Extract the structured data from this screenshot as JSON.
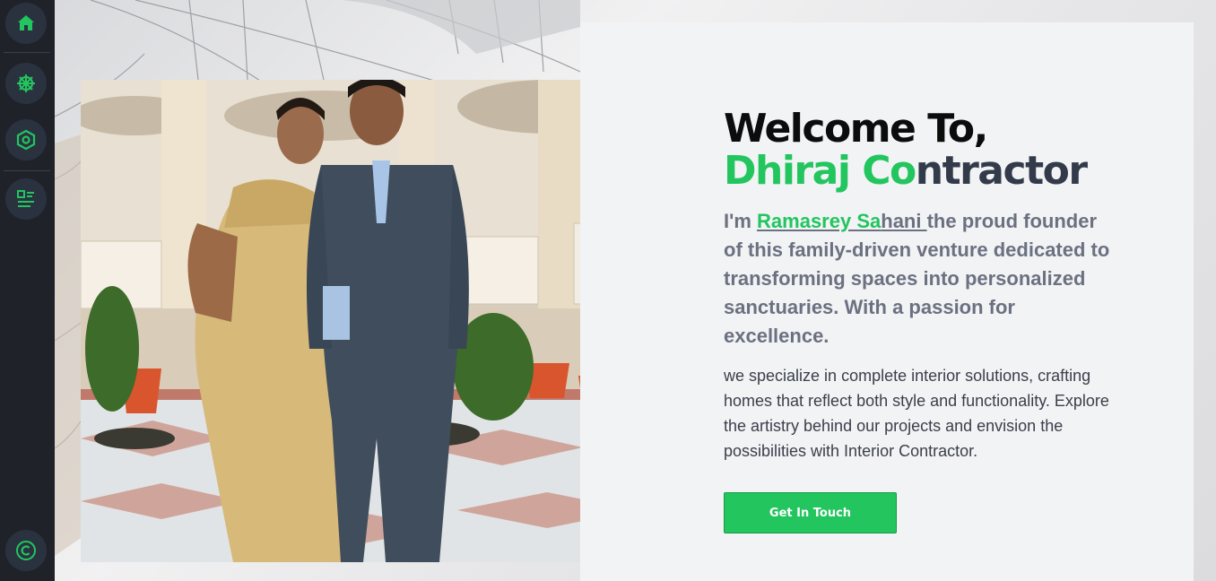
{
  "sidebar": {
    "items": [
      {
        "icon": "home-icon",
        "label": "Home"
      },
      {
        "icon": "helm-icon",
        "label": "Services"
      },
      {
        "icon": "hexagon-icon",
        "label": "Projects"
      },
      {
        "icon": "list-icon",
        "label": "Details"
      }
    ],
    "footer_icon": "copyright-icon"
  },
  "hero": {
    "title_line1": "Welcome To,",
    "title_line2_green": "Dhiraj Co",
    "title_line2_dark": "ntractor",
    "lead_prefix": "I'm ",
    "name_green": "Ramasrey Sa",
    "name_dark": "hani ",
    "lead_rest": "the proud founder of this family-driven venture dedicated to transforming spaces into personalized sanctuaries. With a passion for excellence.",
    "body": "we specialize in complete interior solutions, crafting homes that reflect both style and functionality. Explore the artistry behind our projects and envision the possibilities with Interior Contractor.",
    "cta_label": "Get In Touch"
  },
  "colors": {
    "accent": "#22c55e",
    "sidebar_bg": "#1f2229",
    "dark_text": "#333b4b"
  }
}
